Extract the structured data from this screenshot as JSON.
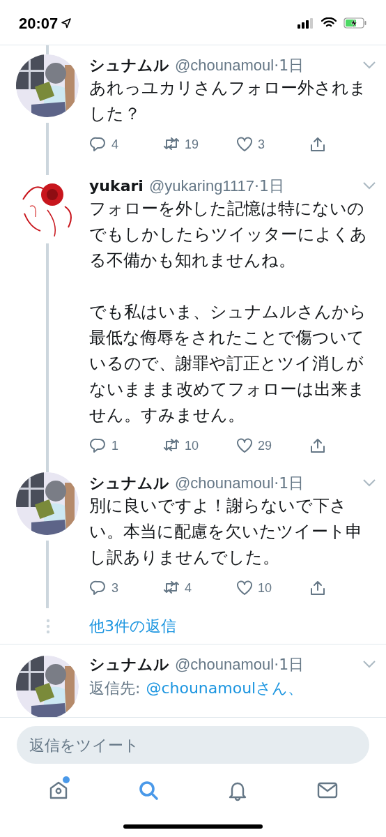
{
  "status_bar": {
    "time": "20:07"
  },
  "tweets": [
    {
      "name": "シュナムル",
      "handle": "@chounamoul",
      "time": "·1日",
      "body": [
        "あれっユカリさんフォロー外されました？"
      ],
      "replies": "4",
      "retweets": "19",
      "likes": "3",
      "in_thread": true
    },
    {
      "name": "yukari",
      "handle": "@yukaring1117",
      "time": "·1日",
      "body": [
        "フォローを外した記憶は特にないのでもしかしたらツイッターによくある不備かも知れませんね。",
        "でも私はいま、シュナムルさんから最低な侮辱をされたことで傷ついているので、謝罪や訂正とツイ消しがないままま改めてフォローは出来ません。すみません。"
      ],
      "replies": "1",
      "retweets": "10",
      "likes": "29",
      "in_thread": true
    },
    {
      "name": "シュナムル",
      "handle": "@chounamoul",
      "time": "·1日",
      "body": [
        "別に良いですよ！謝らないで下さい。本当に配慮を欠いたツイート申し訳ありませんでした。"
      ],
      "replies": "3",
      "retweets": "4",
      "likes": "10",
      "in_thread": true
    }
  ],
  "more_replies": "他3件の返信",
  "last_tweet": {
    "name": "シュナムル",
    "handle": "@chounamoul",
    "time": "·1日",
    "reply_prefix": "返信先:",
    "mentions": [
      "@chounamoulさん、"
    ]
  },
  "reply_field": {
    "placeholder": "返信をツイート"
  },
  "tabs": [
    {
      "kind": "home",
      "selected": false,
      "dot": true
    },
    {
      "kind": "search",
      "selected": true,
      "dot": false
    },
    {
      "kind": "notifications",
      "selected": false,
      "dot": false
    },
    {
      "kind": "messages",
      "selected": false,
      "dot": false
    }
  ]
}
